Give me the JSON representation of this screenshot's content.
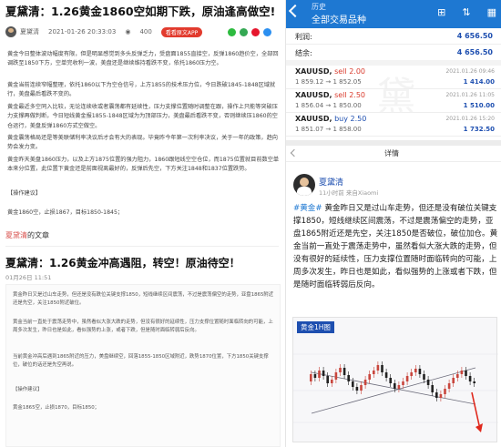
{
  "left": {
    "article1": {
      "title": "夏黛清：1.26黄金1860空如期下跌，原油逢高做空!",
      "author": "夏黛清",
      "datetime": "2021-01-26 20:33:03",
      "views": "400",
      "app_button": "看看原文APP",
      "paragraphs": [
        "黄金今日整体波动幅度有限，但是明显感觉到多头反弹乏力，受盘面1855直接空，反弹1860趋价空，全部回调跌至1850下方，空单完收利一波，美盘还是继续维持看跌不变，依托1860压力空。",
        "黄金当前连续窄幅整理，依托1860以下为空仓信号，上方1855的技术压力位，今日跌破1845-1848区域就行，美盘最后看跌不变的。",
        "黄金最近多空同入比较，无论连续收或者震荡都有延续性，压力支撑位置随时调整在跟，操作上只能等突破压力支撑再做判断，今日短线黄金报1855-1848区域为为顶部压力，美盘最后看跌不变，否则继续压1860的空仓运行，美盘反弹1860方式空做空。",
        "黄金震荡格局还是等美联储利率决议后才会有大的表现。毕竟昨今年第一次利率决议，关于一年的政策，趋向势会发力变。",
        "黄金昨天美盘1860压力，以及上方1875位置的强力阻力，1860跟短线空空仓位，而1875位置就目前数空单本来分位置，此位置下黄金还是前面视离最好的，反弹后先空，下方关注1848和1837位置跌势。",
        "【操作建议】",
        "黄金1860空，止损1867，目标1850-1845；"
      ]
    },
    "article2": {
      "tag": "夏黛清",
      "tag_suffix": "的文章",
      "title": "夏黛清：1.26黄金冲高遇阻，转空！原油待空！",
      "date": "01月26日 11:51",
      "paragraphs": [
        "黄金昨日又是过山车走势，但还是没有跌位关键支撑1850，短线继续区间震荡，不过是震荡偏空的走势，亚盘1865附近还是先空，关注1850附近破位。",
        "黄金当前一直处于震荡走势中，虽然看似大涨大跌的走势，但没有很好的延续性，压力支撑位置随时面临转向的可能，上周多次发生，昨日也是如此，看似强势的上涨，或者下跌，但是随时面临转弱后反向。",
        "当前黄金冲高后遇到1865附近的压力，美盘继续空，回落1855-1850区域附近，跌势1870位置，下方1850关键支撑位，破位的话还是先空再说。",
        "【操作建议】",
        "黄金1865空，止损1870，目标1850；"
      ]
    }
  },
  "right": {
    "topbar": {
      "small": "历史",
      "title": "全部交易品种",
      "icons": [
        "plus-icon",
        "sort-icon",
        "calendar-icon"
      ]
    },
    "account": [
      {
        "key": "利润:",
        "value": "4 656.50"
      },
      {
        "key": "结余:",
        "value": "4 656.50"
      }
    ],
    "orders": [
      {
        "symbol": "XAUUSD,",
        "side": "sell",
        "lots": "2.00",
        "prices": "1 859.12 → 1 852.05",
        "time": "2021.01.26 09:46",
        "profit": "1 414.00"
      },
      {
        "symbol": "XAUUSD,",
        "side": "sell",
        "lots": "2.50",
        "prices": "1 856.04 → 1 850.00",
        "time": "2021.01.26 11:05",
        "profit": "1 510.00"
      },
      {
        "symbol": "XAUUSD,",
        "side": "buy",
        "lots": "2.50",
        "prices": "1 851.07 → 1 858.00",
        "time": "2021.01.26 15:20",
        "profit": "1 732.50"
      }
    ],
    "detail": {
      "title": "详情",
      "author": "夏黛清",
      "sub": "11小时前  来自Xiaomi",
      "hashtag": "#黄金#",
      "text": " 黄金昨日又是过山车走势，但还是没有破位关键支撑1850，短线继续区间震荡，不过是震荡偏空的走势，亚盘1865附近还是先空，关注1850是否破位，破位加仓。黄金当前一直处于震荡走势中，虽然看似大涨大跌的走势，但没有很好的延续性，压力支撑位置随时面临转向的可能，上周多次发生，昨日也是如此，看似强势的上涨或者下跌，但是随时面临转弱后反向。",
      "chart_label": "黄金1H图"
    }
  },
  "colors": {
    "topbar": "#1e78d2",
    "sell": "#d93a2c",
    "buy": "#1e4fb0",
    "accent_red": "#e23b2e"
  }
}
